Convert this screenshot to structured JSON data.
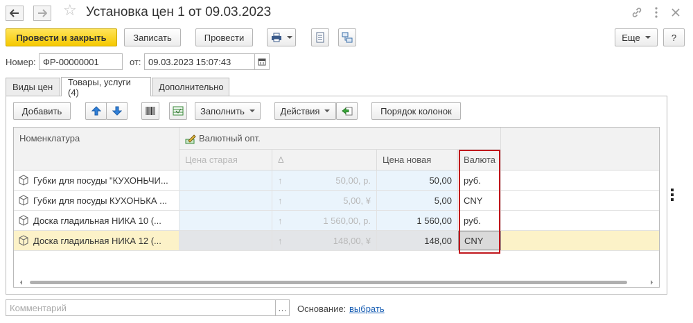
{
  "window": {
    "title": "Установка цен 1 от 09.03.2023"
  },
  "toolbar": {
    "post_close": "Провести и закрыть",
    "save": "Записать",
    "post": "Провести",
    "more": "Еще",
    "help": "?"
  },
  "header": {
    "number_label": "Номер:",
    "number_value": "ФР-00000001",
    "date_label": "от:",
    "date_value": "09.03.2023 15:07:43"
  },
  "tabs": [
    {
      "label": "Виды цен"
    },
    {
      "label": "Товары, услуги (4)"
    },
    {
      "label": "Дополнительно"
    }
  ],
  "grid_toolbar": {
    "add": "Добавить",
    "fill": "Заполнить",
    "actions": "Действия",
    "column_order": "Порядок колонок"
  },
  "grid": {
    "col_item": "Номенклатура",
    "col_group": "Валютный опт.",
    "col_old_price": "Цена старая",
    "col_delta": "Δ",
    "col_new_price": "Цена новая",
    "col_currency": "Валюта",
    "rows": [
      {
        "item": "Губки для посуды \"КУХОНЬЧИ...",
        "old_price": "50,00, р.",
        "new_price": "50,00",
        "currency": "руб."
      },
      {
        "item": "Губки для посуды КУХОНЬКА ...",
        "old_price": "5,00, ¥",
        "new_price": "5,00",
        "currency": "CNY"
      },
      {
        "item": "Доска гладильная  НИКА 10 (...",
        "old_price": "1 560,00, р.",
        "new_price": "1 560,00",
        "currency": "руб."
      },
      {
        "item": "Доска гладильная  НИКА 12 (...",
        "old_price": "148,00, ¥",
        "new_price": "148,00",
        "currency": "CNY"
      }
    ]
  },
  "footer": {
    "comment_placeholder": "Комментарий",
    "basis_label": "Основание:",
    "basis_link": "выбрать"
  },
  "colors": {
    "primary_button": "#f5c800",
    "highlight_border": "#c0161c",
    "selected_row": "#fcf2c8",
    "link": "#1a5fb4"
  }
}
